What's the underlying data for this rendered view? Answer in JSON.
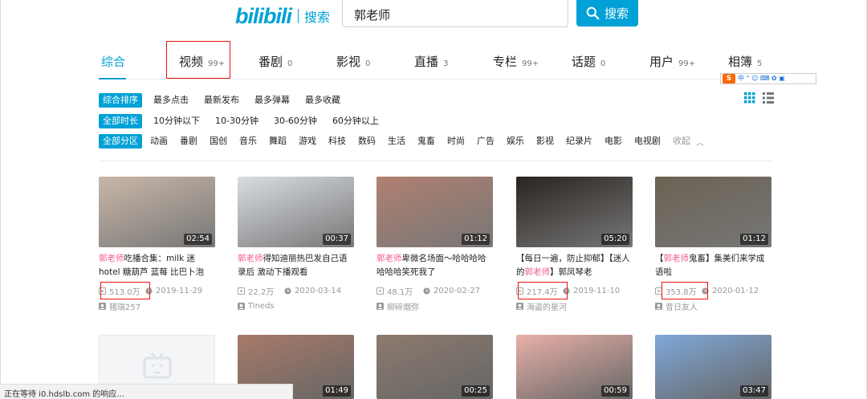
{
  "header": {
    "logo_text": "bilibili",
    "logo_search": "搜索",
    "query": "郭老师",
    "search_button": "搜索"
  },
  "tabs": [
    {
      "label": "综合",
      "count": ""
    },
    {
      "label": "视频",
      "count": "99+"
    },
    {
      "label": "番剧",
      "count": "0"
    },
    {
      "label": "影视",
      "count": "0"
    },
    {
      "label": "直播",
      "count": "3"
    },
    {
      "label": "专栏",
      "count": "99+"
    },
    {
      "label": "话题",
      "count": "0"
    },
    {
      "label": "用户",
      "count": "99+"
    },
    {
      "label": "相簿",
      "count": "5"
    }
  ],
  "filters": {
    "order": [
      "综合排序",
      "最多点击",
      "最新发布",
      "最多弹幕",
      "最多收藏"
    ],
    "duration": [
      "全部时长",
      "10分钟以下",
      "10-30分钟",
      "30-60分钟",
      "60分钟以上"
    ],
    "zone": [
      "全部分区",
      "动画",
      "番剧",
      "国创",
      "音乐",
      "舞蹈",
      "游戏",
      "科技",
      "数码",
      "生活",
      "鬼畜",
      "时尚",
      "广告",
      "娱乐",
      "影视",
      "纪录片",
      "电影",
      "电视剧",
      "收起"
    ]
  },
  "ime": {
    "logo": "S",
    "glyphs": "中 ° ☺ ⌨ ✿ ▣"
  },
  "videos": [
    {
      "duration": "02:54",
      "title_hl": "郭老师",
      "title_rest": "吃播合集：milk 迷hotel 糖葫芦 蓝莓 比巴卜泡",
      "title_pre": "",
      "views": "513.0万",
      "date": "2019-11-29",
      "author": "猪瑞257"
    },
    {
      "duration": "00:37",
      "title_hl": "郭老师",
      "title_rest": "得知迪丽热巴发自己语录后 激动下播观看",
      "title_pre": "",
      "views": "22.2万",
      "date": "2020-03-14",
      "author": "Tineds"
    },
    {
      "duration": "01:12",
      "title_hl": "郭老师",
      "title_rest": "卑微名场面～哈哈哈哈哈哈哈笑死我了",
      "title_pre": "",
      "views": "48.1万",
      "date": "2020-02-27",
      "author": "柳碎烟弥"
    },
    {
      "duration": "05:20",
      "title_hl": "郭老师",
      "title_rest": "】郭凤琴老",
      "title_pre": "【每日一遍，防止抑郁】【迷人的",
      "views": "217.4万",
      "date": "2019-11-10",
      "author": "海盗的星河"
    },
    {
      "duration": "01:12",
      "title_hl": "郭老师",
      "title_rest": "鬼畜】集美们来学成语啦",
      "title_pre": "【",
      "views": "353.8万",
      "date": "2020-01-12",
      "author": "昔日友人"
    }
  ],
  "row2_durations": [
    "",
    "01:49",
    "00:25",
    "00:59",
    "03:47"
  ],
  "thumb_colors": [
    "#c9b7a8",
    "#d9dde3",
    "#b08070",
    "#2a2420",
    "#6b6253"
  ],
  "status_text": "正在等待 i0.hdslb.com 的响应..."
}
